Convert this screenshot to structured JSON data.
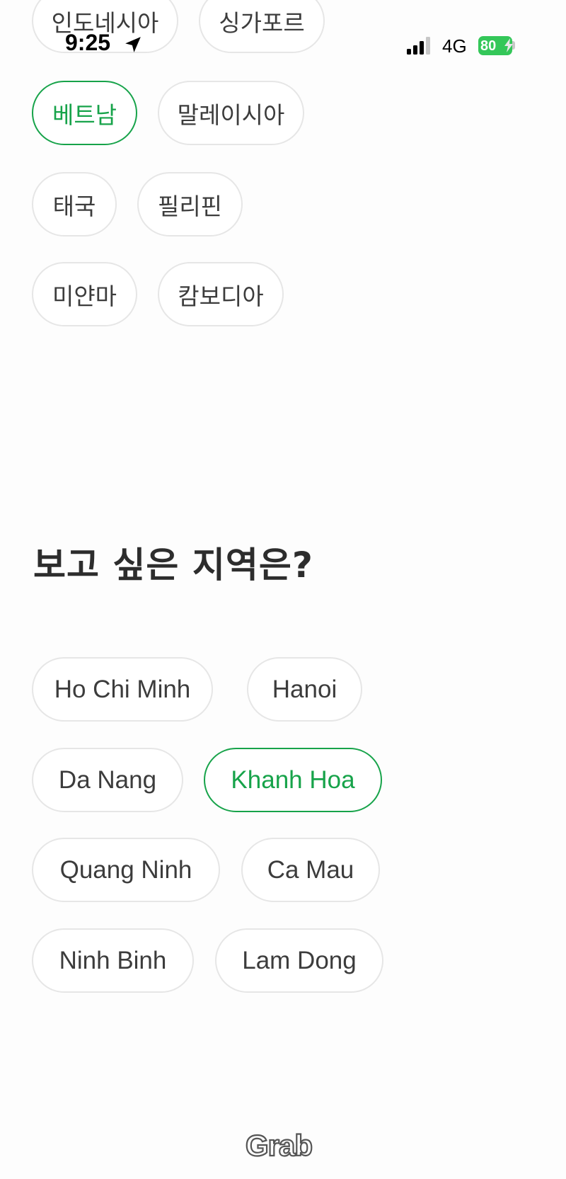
{
  "status_bar": {
    "time": "9:25",
    "network": "4G",
    "battery": "80"
  },
  "countries": [
    {
      "label": "인도네시아",
      "selected": false
    },
    {
      "label": "싱가포르",
      "selected": false
    },
    {
      "label": "베트남",
      "selected": true
    },
    {
      "label": "말레이시아",
      "selected": false
    },
    {
      "label": "태국",
      "selected": false
    },
    {
      "label": "필리핀",
      "selected": false
    },
    {
      "label": "미얀마",
      "selected": false
    },
    {
      "label": "캄보디아",
      "selected": false
    }
  ],
  "region_question": "보고 싶은 지역은?",
  "regions": [
    {
      "label": "Ho Chi Minh",
      "selected": false
    },
    {
      "label": "Hanoi",
      "selected": false
    },
    {
      "label": "Da Nang",
      "selected": false
    },
    {
      "label": "Khanh Hoa",
      "selected": true
    },
    {
      "label": "Quang Ninh",
      "selected": false
    },
    {
      "label": "Ca Mau",
      "selected": false
    },
    {
      "label": "Ninh Binh",
      "selected": false
    },
    {
      "label": "Lam Dong",
      "selected": false
    }
  ],
  "brand": {
    "logo_text": "Grab",
    "accent_color": "#17a34a"
  }
}
